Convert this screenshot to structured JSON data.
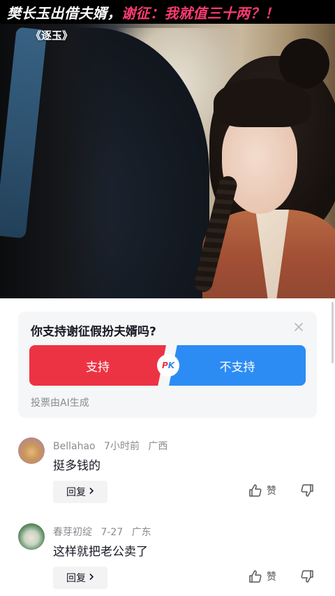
{
  "video": {
    "headline_part1": "樊长玉出借夫婿，",
    "headline_part2": "谢征：我就值三十两？！",
    "show_title": "《逐玉》"
  },
  "poll": {
    "question": "你支持谢征假扮夫婿吗?",
    "option_support": "支持",
    "option_oppose": "不支持",
    "pk_p": "P",
    "pk_k": "K",
    "note": "投票由AI生成",
    "colors": {
      "support": "#ec3344",
      "oppose": "#2c8cf4"
    }
  },
  "comments": [
    {
      "username": "Bellahao",
      "time": "7小时前",
      "location": "广西",
      "text": "挺多钱的",
      "reply_label": "回复",
      "like_label": "赞"
    },
    {
      "username": "春芽初绽",
      "time": "7-27",
      "location": "广东",
      "text": "这样就把老公卖了",
      "reply_label": "回复",
      "like_label": "赞"
    }
  ]
}
